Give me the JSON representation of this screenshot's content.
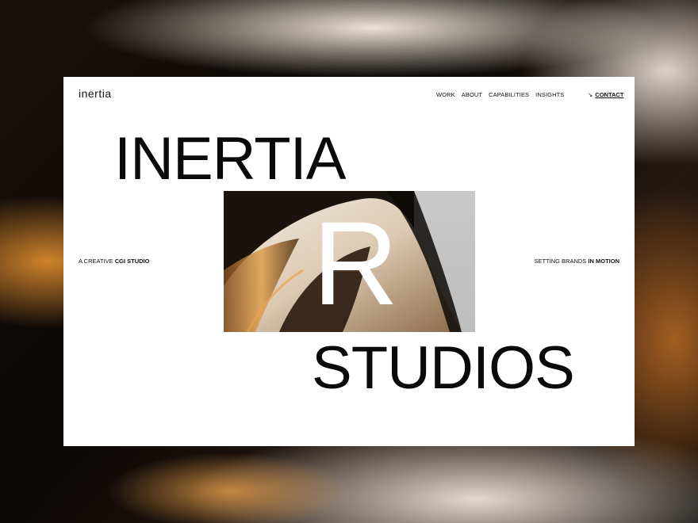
{
  "brand": {
    "logo_text": "inertia"
  },
  "nav": {
    "items": [
      {
        "label": "WORK"
      },
      {
        "label": "ABOUT"
      },
      {
        "label": "CAPABILITIES"
      },
      {
        "label": "INSIGHTS"
      }
    ],
    "contact": {
      "arrow": "↘",
      "label": "CONTACT"
    }
  },
  "hero": {
    "title_top": "INERTIA",
    "center_letter": "R",
    "title_bottom": "STUDIOS",
    "left_tagline": {
      "prefix": "A CREATIVE ",
      "emphasis": "CGI STUDIO"
    },
    "right_tagline": {
      "prefix": "SETTING BRANDS ",
      "emphasis": "IN MOTION"
    }
  },
  "colors": {
    "background": "#0b0806",
    "card": "#ffffff",
    "text": "#0a0a0a",
    "accent_gold": "#d98a2c",
    "accent_cream": "#f1e7da"
  }
}
